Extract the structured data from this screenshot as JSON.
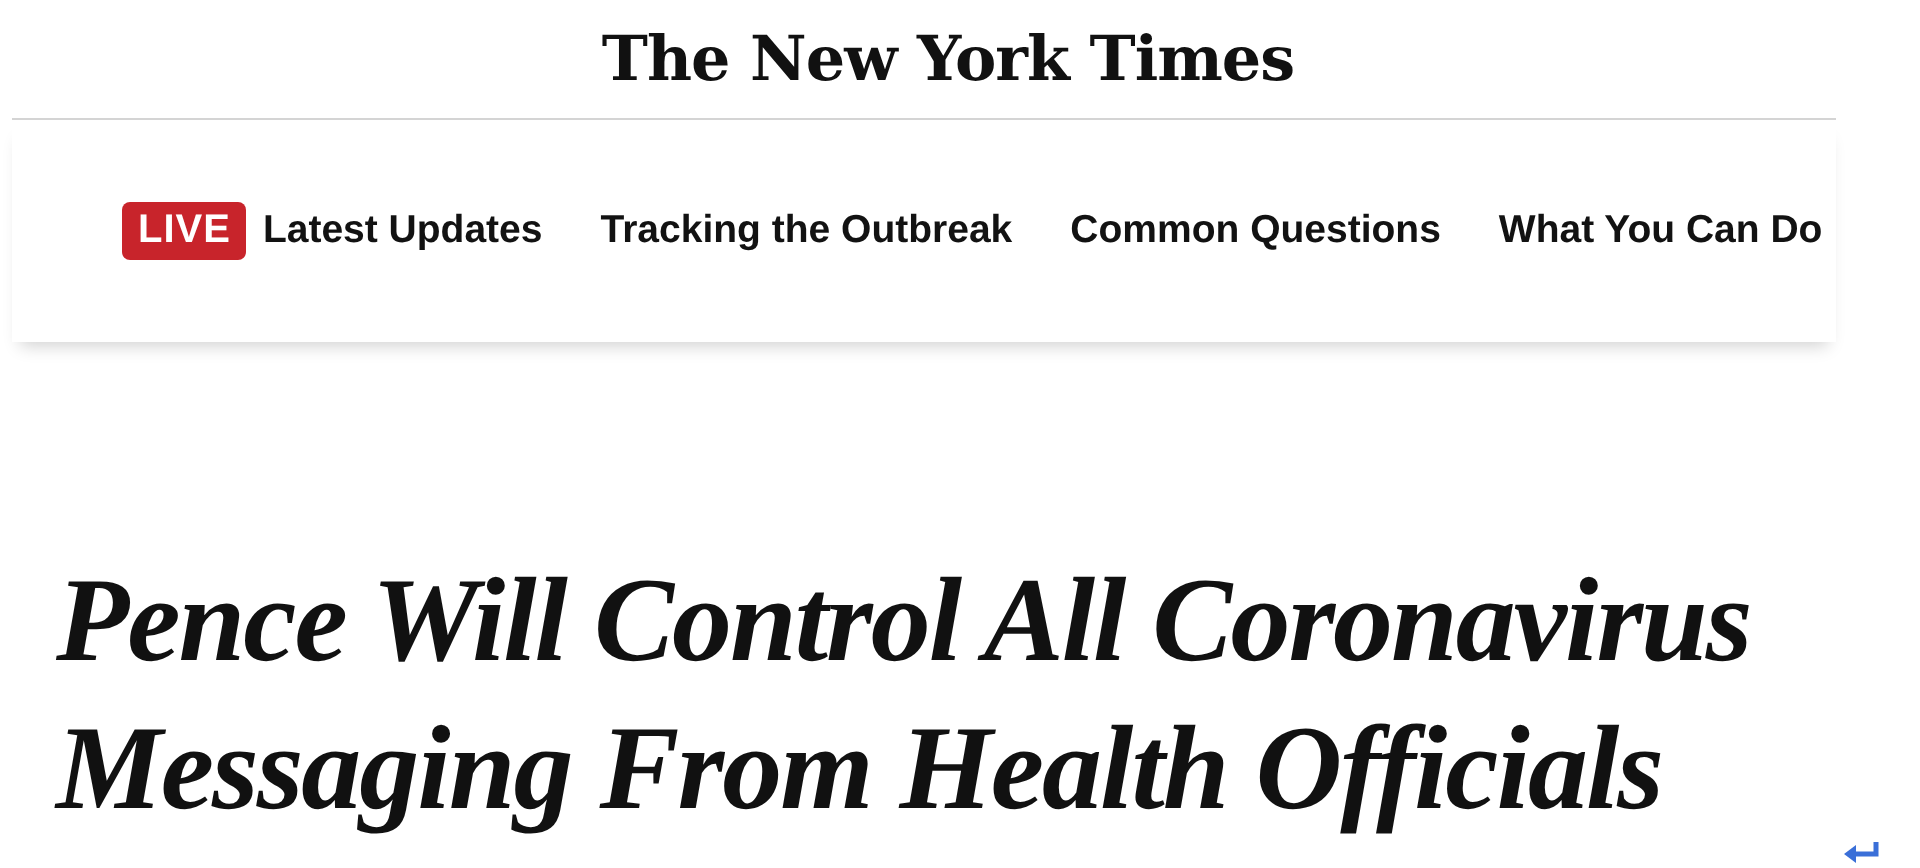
{
  "masthead": {
    "logo": "The New York Times"
  },
  "nav": {
    "badge": "LIVE",
    "links": [
      "Latest Updates",
      "Tracking the Outbreak",
      "Common Questions",
      "What You Can Do"
    ]
  },
  "headline": "Pence Will Control All Coronavirus Messaging From Health Officials"
}
